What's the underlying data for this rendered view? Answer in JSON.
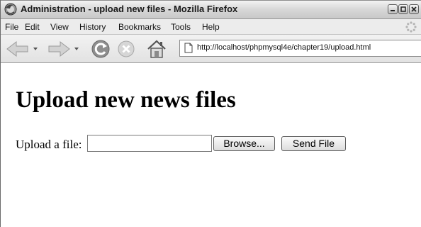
{
  "window": {
    "title": "Administration - upload new files - Mozilla Firefox"
  },
  "menu": {
    "items": [
      "File",
      "Edit",
      "View",
      "History",
      "Bookmarks",
      "Tools",
      "Help"
    ]
  },
  "toolbar": {
    "url": "http://localhost/phpmysql4e/chapter19/upload.html"
  },
  "page": {
    "heading": "Upload new news files",
    "upload_label": "Upload a file:",
    "file_input_value": "",
    "browse_label": "Browse...",
    "send_label": "Send File"
  },
  "icons": {
    "app": "firefox-icon",
    "back": "back-arrow-icon",
    "forward": "forward-arrow-icon",
    "reload": "reload-icon",
    "stop": "stop-icon",
    "home": "home-icon",
    "page": "page-icon",
    "throbber": "throbber-icon"
  }
}
